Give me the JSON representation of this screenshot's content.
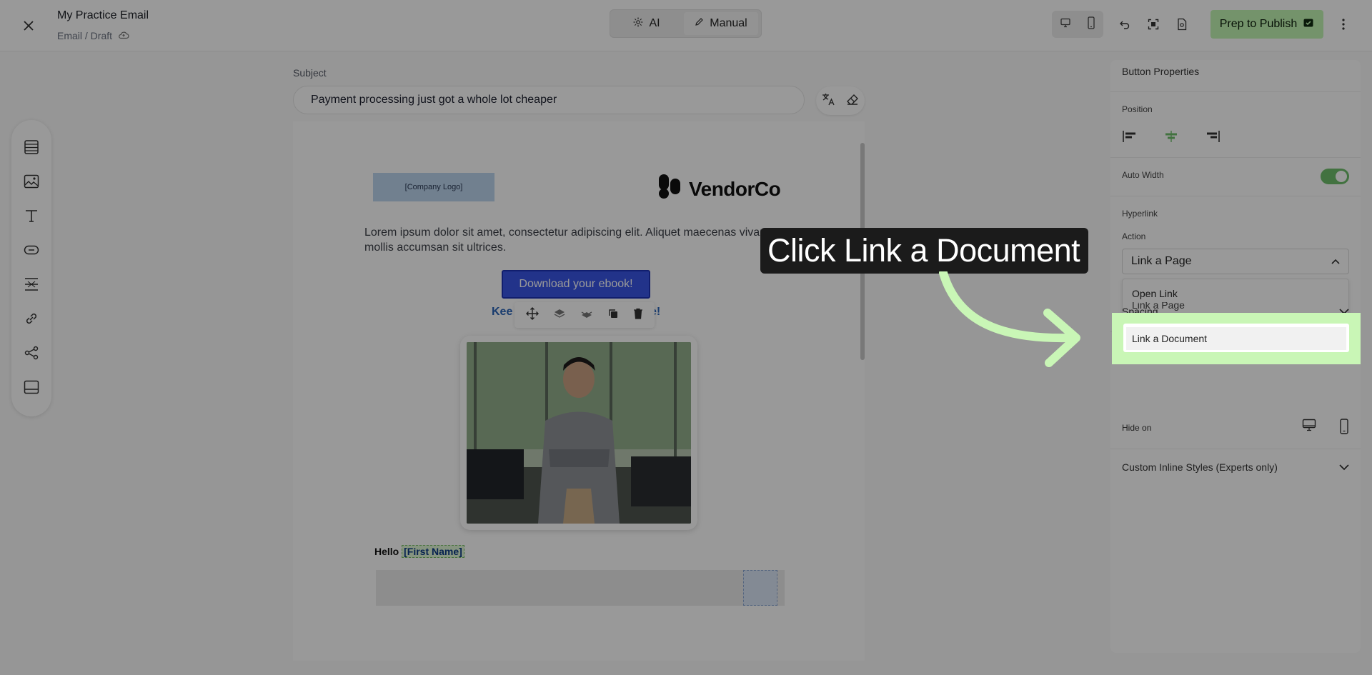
{
  "header": {
    "title": "My Practice Email",
    "breadcrumb": "Email / Draft",
    "modes": [
      "AI",
      "Manual"
    ],
    "publish_label": "Prep to Publish"
  },
  "subject": {
    "label": "Subject",
    "value": "Payment processing just got a whole lot cheaper"
  },
  "email": {
    "company_logo": "[Company Logo]",
    "brand_name": "VendorCo",
    "body_text": "Lorem ipsum dolor sit amet, consectetur adipiscing elit. Aliquet maecenas vivamus mollis accumsan sit ultrices.",
    "cta_label": "Download your ebook!",
    "keep_text_start": "Kee",
    "keep_text_end": "e!",
    "greeting": "Hello",
    "first_name_tag": "[First Name]"
  },
  "panel": {
    "title": "Button Properties",
    "position_label": "Position",
    "auto_width_label": "Auto Width",
    "auto_width_on": true,
    "hyperlink_label": "Hyperlink",
    "action_label": "Action",
    "action_value": "Link a Page",
    "options": [
      "Open Link",
      "Link a Page",
      "Link a Document"
    ],
    "spacing_label": "Spacing",
    "hide_on_label": "Hide on",
    "custom_styles_label": "Custom Inline Styles (Experts only)"
  },
  "callout": {
    "text": "Click Link a Document"
  },
  "colors": {
    "accent_green": "#c1f6b3",
    "cta_blue": "#3a55e6"
  }
}
